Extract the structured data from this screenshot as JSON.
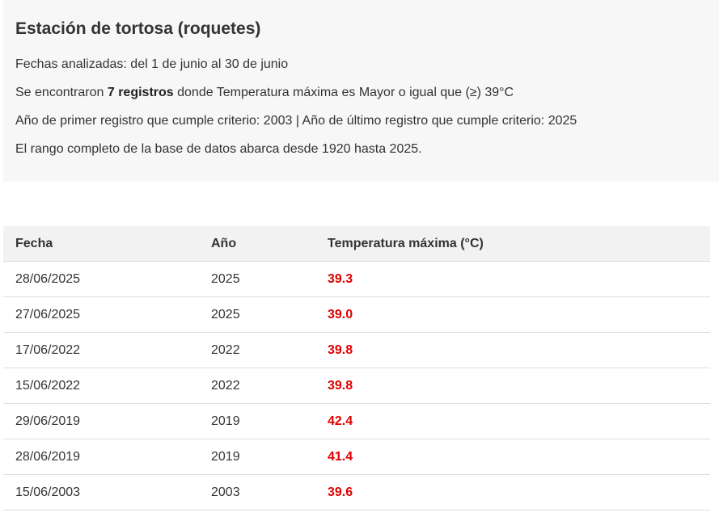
{
  "summary": {
    "title": "Estación de tortosa (roquetes)",
    "dates_line": "Fechas analizadas: del 1 de junio al 30 de junio",
    "found_prefix": "Se encontraron ",
    "found_count": "7 registros",
    "found_suffix": " donde Temperatura máxima es Mayor o igual que (≥) 39°C",
    "years_line": "Año de primer registro que cumple criterio: 2003 | Año de último registro que cumple criterio: 2025",
    "range_line": "El rango completo de la base de datos abarca desde 1920 hasta 2025."
  },
  "table": {
    "headers": [
      "Fecha",
      "Año",
      "Temperatura máxima (°C)"
    ],
    "rows": [
      {
        "fecha": "28/06/2025",
        "anio": "2025",
        "temp": "39.3"
      },
      {
        "fecha": "27/06/2025",
        "anio": "2025",
        "temp": "39.0"
      },
      {
        "fecha": "17/06/2022",
        "anio": "2022",
        "temp": "39.8"
      },
      {
        "fecha": "15/06/2022",
        "anio": "2022",
        "temp": "39.8"
      },
      {
        "fecha": "29/06/2019",
        "anio": "2019",
        "temp": "42.4"
      },
      {
        "fecha": "28/06/2019",
        "anio": "2019",
        "temp": "41.4"
      },
      {
        "fecha": "15/06/2003",
        "anio": "2003",
        "temp": "39.6"
      }
    ]
  },
  "colors": {
    "temp_highlight": "#e00000",
    "summary_bg": "#f7f7f7",
    "header_bg": "#f2f2f2"
  }
}
